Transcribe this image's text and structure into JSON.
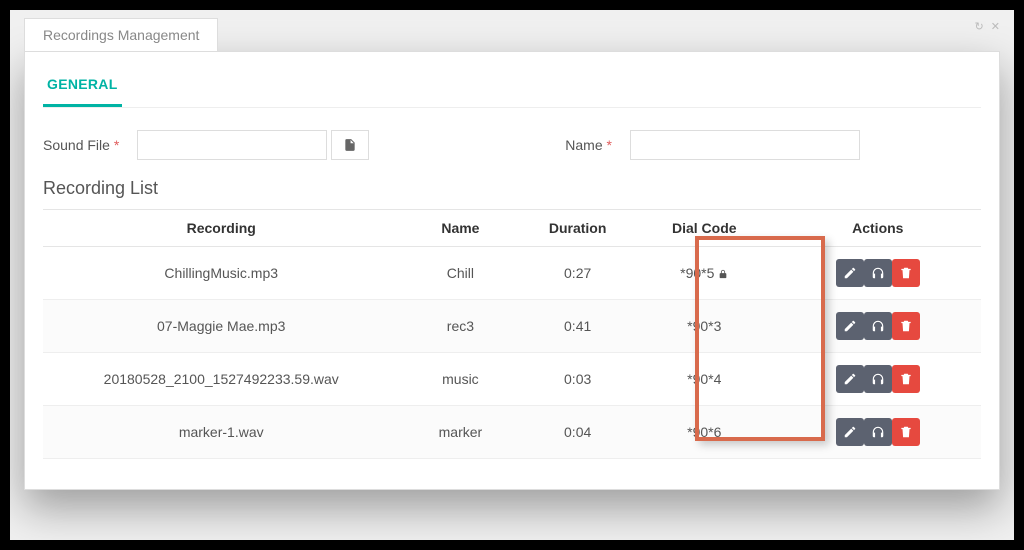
{
  "panel": {
    "title": "Recordings Management"
  },
  "tabs": {
    "general": "GENERAL"
  },
  "form": {
    "sound_file_label": "Sound File",
    "name_label": "Name",
    "sound_file_value": "",
    "name_value": ""
  },
  "list": {
    "title": "Recording List",
    "columns": {
      "recording": "Recording",
      "name": "Name",
      "duration": "Duration",
      "dial_code": "Dial Code",
      "actions": "Actions"
    },
    "rows": [
      {
        "recording": "ChillingMusic.mp3",
        "name": "Chill",
        "duration": "0:27",
        "dial_code": "*90*5",
        "locked": true
      },
      {
        "recording": "07-Maggie Mae.mp3",
        "name": "rec3",
        "duration": "0:41",
        "dial_code": "*90*3",
        "locked": false
      },
      {
        "recording": "20180528_2100_1527492233.59.wav",
        "name": "music",
        "duration": "0:03",
        "dial_code": "*90*4",
        "locked": false
      },
      {
        "recording": "marker-1.wav",
        "name": "marker",
        "duration": "0:04",
        "dial_code": "*90*6",
        "locked": false
      }
    ]
  }
}
